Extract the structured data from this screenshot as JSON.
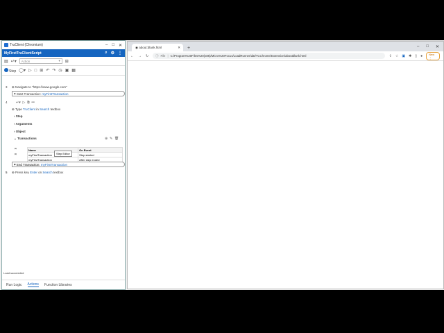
{
  "tc": {
    "window_title": "TruClient (Chromium)",
    "script_name": "MyFirstTruClientScript",
    "action_placeholder": "Action",
    "step_label": "Step",
    "steps": {
      "s3_num": "3",
      "s3_text": "Navigate to \"https://www.google.com\"",
      "start_tx_prefix": "Start Transaction:",
      "start_tx_name": "myFirstTransaction",
      "s4_num": "4",
      "type_prefix": "Type",
      "type_value": "TruClient",
      "type_in": "in",
      "type_target": "Search",
      "type_suffix": "textbox",
      "section_step": "Step",
      "section_arguments": "Arguments",
      "section_object": "Object",
      "section_transactions": "Transactions",
      "end_tx_prefix": "End Transaction:",
      "end_tx_name": "myFirstTransaction",
      "s5_num": "5",
      "press_prefix": "Press key",
      "press_key": "Enter",
      "press_on": "on",
      "press_target": "Search",
      "press_suffix": "textbox"
    },
    "tx_table": {
      "headers": [
        "Name",
        "On Event"
      ],
      "rows": [
        [
          "myFirstTransaction",
          "Step started"
        ],
        [
          "myFirstTransaction",
          "After step ended"
        ]
      ]
    },
    "tooltip": "Step Editor",
    "status": "Load succeeded",
    "bottom_tabs": [
      "Run Logic",
      "Actions",
      "Function Libraries"
    ]
  },
  "chrome": {
    "tab_title": "about:blank.html",
    "omnibox_scheme": "File",
    "omnibox_url": "C:/Program%20Files%20(x86)/Micro%20Focus/LoadRunner/dat/TCChrome/Extension/aboutblank.html",
    "new_label": "New"
  },
  "colors": {
    "accent": "#1565c0",
    "header": "#1565c0"
  }
}
